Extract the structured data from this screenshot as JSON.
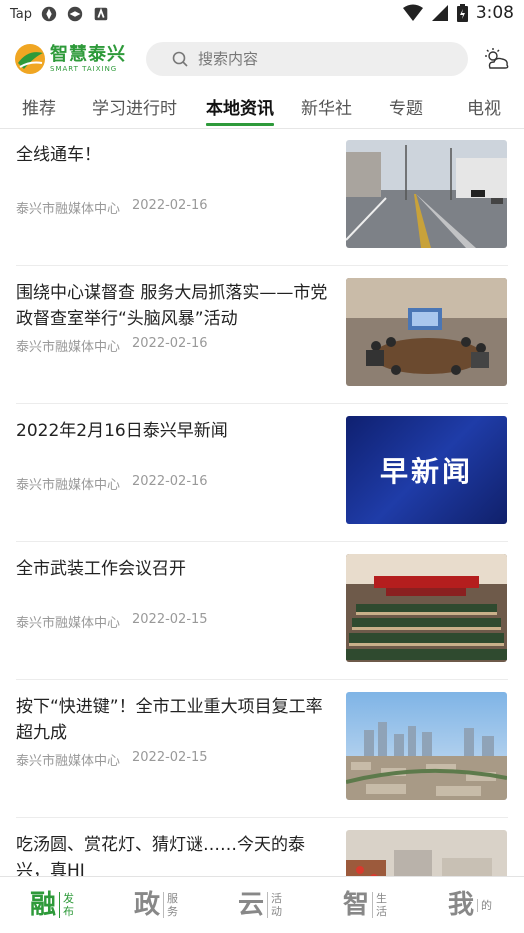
{
  "status_bar": {
    "carrier": "Tap",
    "time": "3:08"
  },
  "header": {
    "logo_cn": "智慧泰兴",
    "logo_en": "SMART TAIXING",
    "search_placeholder": "搜索内容"
  },
  "tabs": [
    {
      "label": "推荐"
    },
    {
      "label": "学习进行时"
    },
    {
      "label": "本地资讯",
      "active": true
    },
    {
      "label": "新华社"
    },
    {
      "label": "专题"
    },
    {
      "label": "电视"
    }
  ],
  "feed": [
    {
      "title": "全线通车！",
      "source": "泰兴市融媒体中心",
      "date": "2022-02-16",
      "thumb": "road-photo"
    },
    {
      "title": "围绕中心谋督查 服务大局抓落实——市党政督查室举行“头脑风暴”活动",
      "source": "泰兴市融媒体中心",
      "date": "2022-02-16",
      "thumb": "meeting-room-photo"
    },
    {
      "title": "2022年2月16日泰兴早新闻",
      "source": "泰兴市融媒体中心",
      "date": "2022-02-16",
      "thumb": "morning-news-banner",
      "thumb_text": "早新闻"
    },
    {
      "title": "全市武装工作会议召开",
      "source": "泰兴市融媒体中心",
      "date": "2022-02-15",
      "thumb": "conference-hall-photo"
    },
    {
      "title": "按下“快进键”！全市工业重大项目复工率超九成",
      "source": "泰兴市融媒体中心",
      "date": "2022-02-15",
      "thumb": "city-skyline-photo"
    },
    {
      "title": "吃汤圆、赏花灯、猜灯谜……今天的泰兴，真HI",
      "source": "",
      "date": "",
      "thumb": "street-photo"
    }
  ],
  "bottom_nav": [
    {
      "big": "融",
      "small": "发布",
      "active": true
    },
    {
      "big": "政",
      "small": "服务"
    },
    {
      "big": "云",
      "small": "活动"
    },
    {
      "big": "智",
      "small": "生活"
    },
    {
      "big": "我",
      "small": "的"
    }
  ],
  "colors": {
    "accent": "#2e9a3a",
    "news_banner": "#1a2f8c"
  }
}
